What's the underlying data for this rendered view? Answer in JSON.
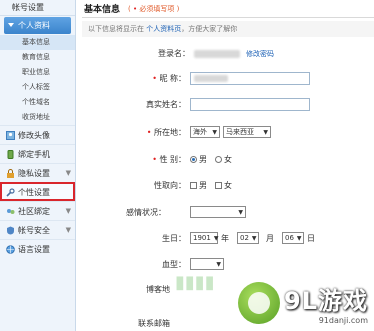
{
  "sidebar": {
    "header": "帐号设置",
    "group": "个人资料",
    "sub_items": [
      "基本信息",
      "教育信息",
      "职业信息",
      "个人标签",
      "个性域名",
      "收货地址"
    ],
    "items": [
      {
        "label": "修改头像",
        "icon": "avatar-icon"
      },
      {
        "label": "绑定手机",
        "icon": "phone-icon"
      },
      {
        "label": "隐私设置",
        "icon": "lock-icon"
      },
      {
        "label": "个性设置",
        "icon": "wrench-icon"
      },
      {
        "label": "社区绑定",
        "icon": "community-icon"
      },
      {
        "label": "帐号安全",
        "icon": "shield-icon"
      },
      {
        "label": "语言设置",
        "icon": "language-icon"
      }
    ]
  },
  "main": {
    "title": "基本信息",
    "required_note": "必须填写项",
    "info_text": "以下信息将显示在",
    "info_link": "个人资料页",
    "info_rest": "，方便大家了解你",
    "login_label": "登录名：",
    "change_password": "修改密码",
    "nickname_label": "昵 称：",
    "realname_label": "真实姓名：",
    "location_label": "所在地：",
    "location_country": "海外",
    "location_region": "马来西亚",
    "gender_label": "性 别：",
    "gender_male": "男",
    "gender_female": "女",
    "orientation_label": "性取向：",
    "orientation_male": "男",
    "orientation_female": "女",
    "relationship_label": "感情状况：",
    "birthday_label": "生日：",
    "birth_year": "1901",
    "year_unit": "年",
    "birth_month": "02",
    "month_unit": "月",
    "birth_day": "06",
    "day_unit": "日",
    "blood_label": "血型：",
    "blog_label": "博客地",
    "contact_label": "联系邮箱"
  },
  "watermark": {
    "brand": "9L游戏",
    "url": "91danji.com"
  }
}
